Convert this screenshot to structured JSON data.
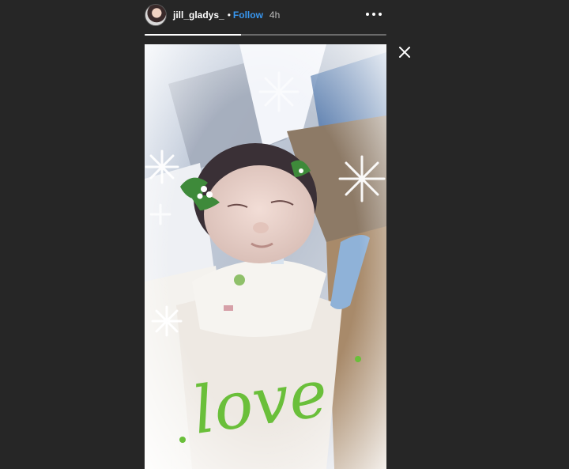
{
  "story": {
    "username": "jill_gladys_",
    "separator": "•",
    "follow_label": "Follow",
    "time_ago": "4h",
    "progress_fraction": 0.4,
    "sticker_text": "love",
    "sticker_color": "#6abf3a"
  },
  "icons": {
    "avatar": "avatar-image",
    "more": "more-options-icon",
    "close": "close-icon"
  },
  "colors": {
    "background": "#262626",
    "follow": "#3897f0"
  }
}
